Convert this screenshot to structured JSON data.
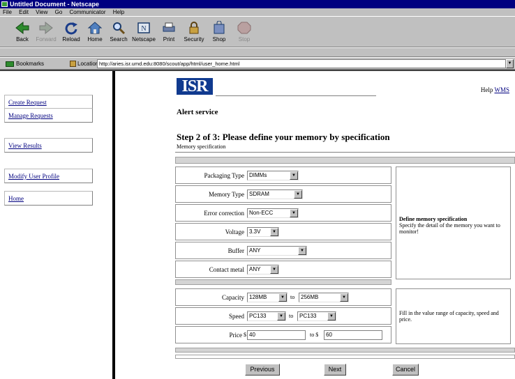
{
  "window": {
    "title": "Untitled Document - Netscape"
  },
  "menu": [
    "File",
    "Edit",
    "View",
    "Go",
    "Communicator",
    "Help"
  ],
  "toolbar": [
    {
      "label": "Back",
      "icon": "back-arrow-icon",
      "enabled": true
    },
    {
      "label": "Forward",
      "icon": "forward-arrow-icon",
      "enabled": false
    },
    {
      "label": "Reload",
      "icon": "reload-icon",
      "enabled": true
    },
    {
      "label": "Home",
      "icon": "home-icon",
      "enabled": true
    },
    {
      "label": "Search",
      "icon": "search-icon",
      "enabled": true
    },
    {
      "label": "Netscape",
      "icon": "netscape-icon",
      "enabled": true
    },
    {
      "label": "Print",
      "icon": "print-icon",
      "enabled": true
    },
    {
      "label": "Security",
      "icon": "security-lock-icon",
      "enabled": true
    },
    {
      "label": "Shop",
      "icon": "shop-icon",
      "enabled": true
    },
    {
      "label": "Stop",
      "icon": "stop-icon",
      "enabled": false
    }
  ],
  "location": {
    "bookmarks_label": "Bookmarks",
    "location_label": "Location:",
    "url": "http://aries.isr.umd.edu:8080/scout/app/html/user_home.html"
  },
  "sidebar": {
    "items": [
      "Create Request",
      "Manage Requests",
      "View Results",
      "Modify User Profile",
      "Home"
    ]
  },
  "header": {
    "logo_text": "ISR",
    "help_label": "Help",
    "help_link": "WMS"
  },
  "page": {
    "alert_title": "Alert service",
    "step_title": "Step 2 of 3: Please define your memory by specification",
    "spec_label": "Memory specification"
  },
  "form": {
    "packaging_type": {
      "label": "Packaging Type",
      "value": "DIMMs"
    },
    "memory_type": {
      "label": "Memory Type",
      "value": "SDRAM"
    },
    "error_correction": {
      "label": "Error correction",
      "value": "Non-ECC"
    },
    "voltage": {
      "label": "Voltage",
      "value": "3.3V"
    },
    "buffer": {
      "label": "Buffer",
      "value": "ANY"
    },
    "contact_metal": {
      "label": "Contact metal",
      "value": "ANY"
    },
    "capacity": {
      "label": "Capacity",
      "from": "128MB",
      "to": "256MB",
      "to_word": "to"
    },
    "speed": {
      "label": "Speed",
      "from": "PC133",
      "to": "PC133",
      "to_word": "to"
    },
    "price": {
      "label": "Price",
      "from_prefix": "$",
      "from": "40",
      "to_word": "to $",
      "to": "60"
    }
  },
  "side_help": {
    "top_title": "Define memory specification",
    "top_body": "Specify the detail of the memory you want to monitor!",
    "bottom_body": "Fill in the value range of capacity, speed and price."
  },
  "buttons": {
    "previous": "Previous",
    "next": "Next",
    "cancel": "Cancel"
  },
  "colors": {
    "title_bar": "#000080",
    "link": "#00007f",
    "logo_bg": "#103a8f"
  }
}
